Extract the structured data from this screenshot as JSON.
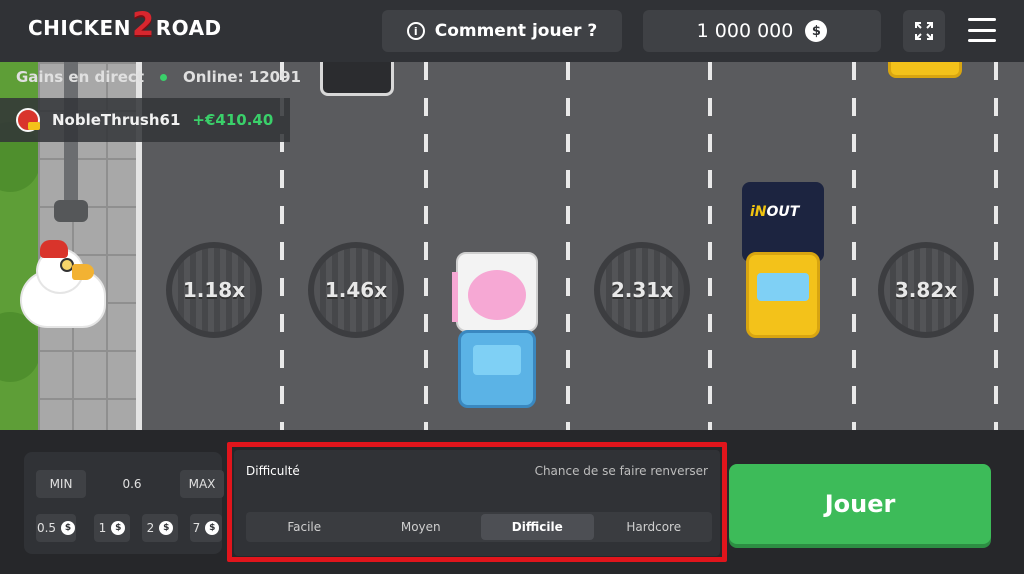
{
  "header": {
    "logo_part1": "CHICKEN",
    "logo_part2": "2",
    "logo_part3": "ROAD",
    "how_to_play": "Comment jouer ?",
    "balance": "1 000 000",
    "currency_symbol": "$"
  },
  "live": {
    "title": "Gains en direct",
    "online": "Online: 12091",
    "player": "NobleThrush61",
    "amount": "+€410.40"
  },
  "multipliers": [
    "1.18x",
    "1.46x",
    "2.31x",
    "3.82x"
  ],
  "truck_brand": {
    "a": "iN",
    "b": "OUT"
  },
  "bet": {
    "min_label": "MIN",
    "value": "0.6",
    "max_label": "MAX",
    "chips": [
      "0.5",
      "1",
      "2",
      "7"
    ],
    "chip_symbol": "$"
  },
  "difficulty": {
    "label": "Difficulté",
    "chance_label": "Chance de se faire renverser",
    "options": [
      "Facile",
      "Moyen",
      "Difficile",
      "Hardcore"
    ],
    "selected": "Difficile"
  },
  "play_button": "Jouer",
  "colors": {
    "accent_green": "#3dbb59",
    "highlight_red": "#e1151c",
    "logo_red": "#d8262e"
  }
}
